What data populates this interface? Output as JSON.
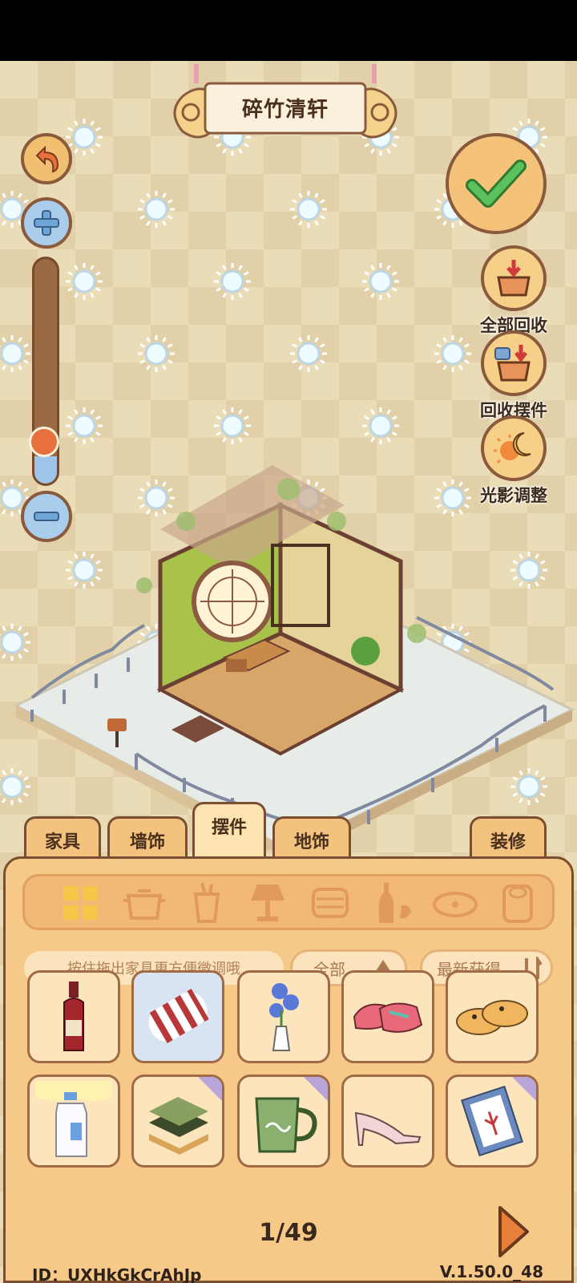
{
  "title": "碎竹清轩",
  "left_controls": {
    "undo": "undo",
    "zoom_in": "zoom-in",
    "zoom_out": "zoom-out",
    "zoom_level": 0.12
  },
  "confirm": "confirm",
  "tools": [
    {
      "label": "全部回收",
      "icon": "recycle-all-icon"
    },
    {
      "label": "回收摆件",
      "icon": "recycle-ornament-icon"
    },
    {
      "label": "光影调整",
      "icon": "day-night-icon"
    }
  ],
  "tabs": [
    {
      "label": "家具",
      "active": false
    },
    {
      "label": "墙饰",
      "active": false
    },
    {
      "label": "摆件",
      "active": true
    },
    {
      "label": "地饰",
      "active": false
    },
    {
      "label": "装修",
      "active": false
    }
  ],
  "categories": [
    "all-grid-icon",
    "pot-icon",
    "cup-icon",
    "lamp-icon",
    "pillow-icon",
    "bottle-icon",
    "pet-bowl-icon",
    "paper-roll-icon"
  ],
  "hint": "按住拖出家具更方便微调哦",
  "filter": {
    "label": "全部"
  },
  "sort": {
    "label": "最新获得"
  },
  "items": [
    {
      "name": "wine-bottle",
      "selected": false,
      "new": false
    },
    {
      "name": "striped-pillow",
      "selected": true,
      "new": false
    },
    {
      "name": "flower-vase",
      "selected": false,
      "new": false
    },
    {
      "name": "pink-sneakers",
      "selected": false,
      "new": false
    },
    {
      "name": "bunny-slippers",
      "selected": false,
      "new": false
    },
    {
      "name": "milk-bottle",
      "selected": false,
      "new": false
    },
    {
      "name": "book-stack",
      "selected": false,
      "new": true
    },
    {
      "name": "green-mug",
      "selected": false,
      "new": true
    },
    {
      "name": "high-heels",
      "selected": false,
      "new": false
    },
    {
      "name": "photo-frame",
      "selected": false,
      "new": true
    }
  ],
  "pagination": "1/49",
  "footer": {
    "id": "ID：UXHkGkCrAhJp",
    "version": "V.1.50.0_48"
  },
  "colors": {
    "accent": "#f2c27e",
    "border": "#7a4e30",
    "confirm": "#4bb04b"
  }
}
